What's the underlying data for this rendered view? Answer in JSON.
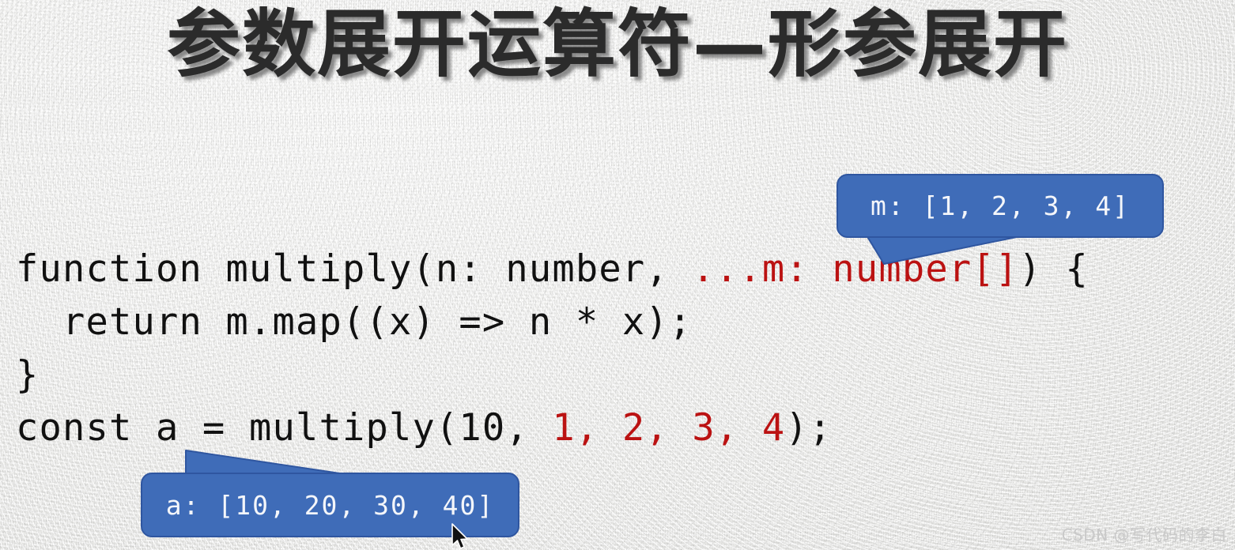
{
  "slide": {
    "title": "参数展开运算符—形参展开",
    "background_color": "#f1f1ef",
    "title_color": "#2b2b2b"
  },
  "code": {
    "font_color": "#111111",
    "highlight_color": "#bb1212",
    "lines": [
      {
        "id": "line-1",
        "segments": [
          {
            "text": "function multiply(n: number, ",
            "color": "black"
          },
          {
            "text": "...m: number[]",
            "color": "red"
          },
          {
            "text": ") {",
            "color": "black"
          }
        ],
        "plain": "function multiply(n: number, ...m: number[]) {"
      },
      {
        "id": "line-2",
        "segments": [
          {
            "text": "  return m.map((x) => n * x);",
            "color": "black"
          }
        ],
        "plain": "  return m.map((x) => n * x);"
      },
      {
        "id": "line-3",
        "segments": [
          {
            "text": "}",
            "color": "black"
          }
        ],
        "plain": "}"
      },
      {
        "id": "line-4",
        "segments": [
          {
            "text": "const a = multiply(10, ",
            "color": "black"
          },
          {
            "text": "1, 2, 3, 4",
            "color": "red"
          },
          {
            "text": ");",
            "color": "black"
          }
        ],
        "plain": "const a = multiply(10, 1, 2, 3, 4);"
      }
    ],
    "line1_black_prefix": "function multiply(n: number, ",
    "line1_red": "...m: number[]",
    "line1_black_suffix": ") {",
    "line2": "  return m.map((x) => n * x);",
    "line3": "}",
    "line4_black_prefix": "const a = multiply(10, ",
    "line4_red": "1, 2, 3, 4",
    "line4_black_suffix": ");"
  },
  "callouts": [
    {
      "id": "callout-m",
      "label": "m: [1, 2, 3, 4]",
      "fill_color": "#3f6cb8",
      "border_color": "#2f56a0",
      "text_color": "#f4f6fa",
      "tail_direction": "down-left"
    },
    {
      "id": "callout-a",
      "label": "a: [10, 20, 30, 40]",
      "fill_color": "#3f6cb8",
      "border_color": "#2f56a0",
      "text_color": "#f4f6fa",
      "tail_direction": "up-left"
    }
  ],
  "callout_m_label": "m: [1, 2, 3, 4]",
  "callout_a_label": "a: [10, 20, 30, 40]",
  "watermark": {
    "text": "CSDN @写代码的李白",
    "color": "#c9c9c9"
  }
}
